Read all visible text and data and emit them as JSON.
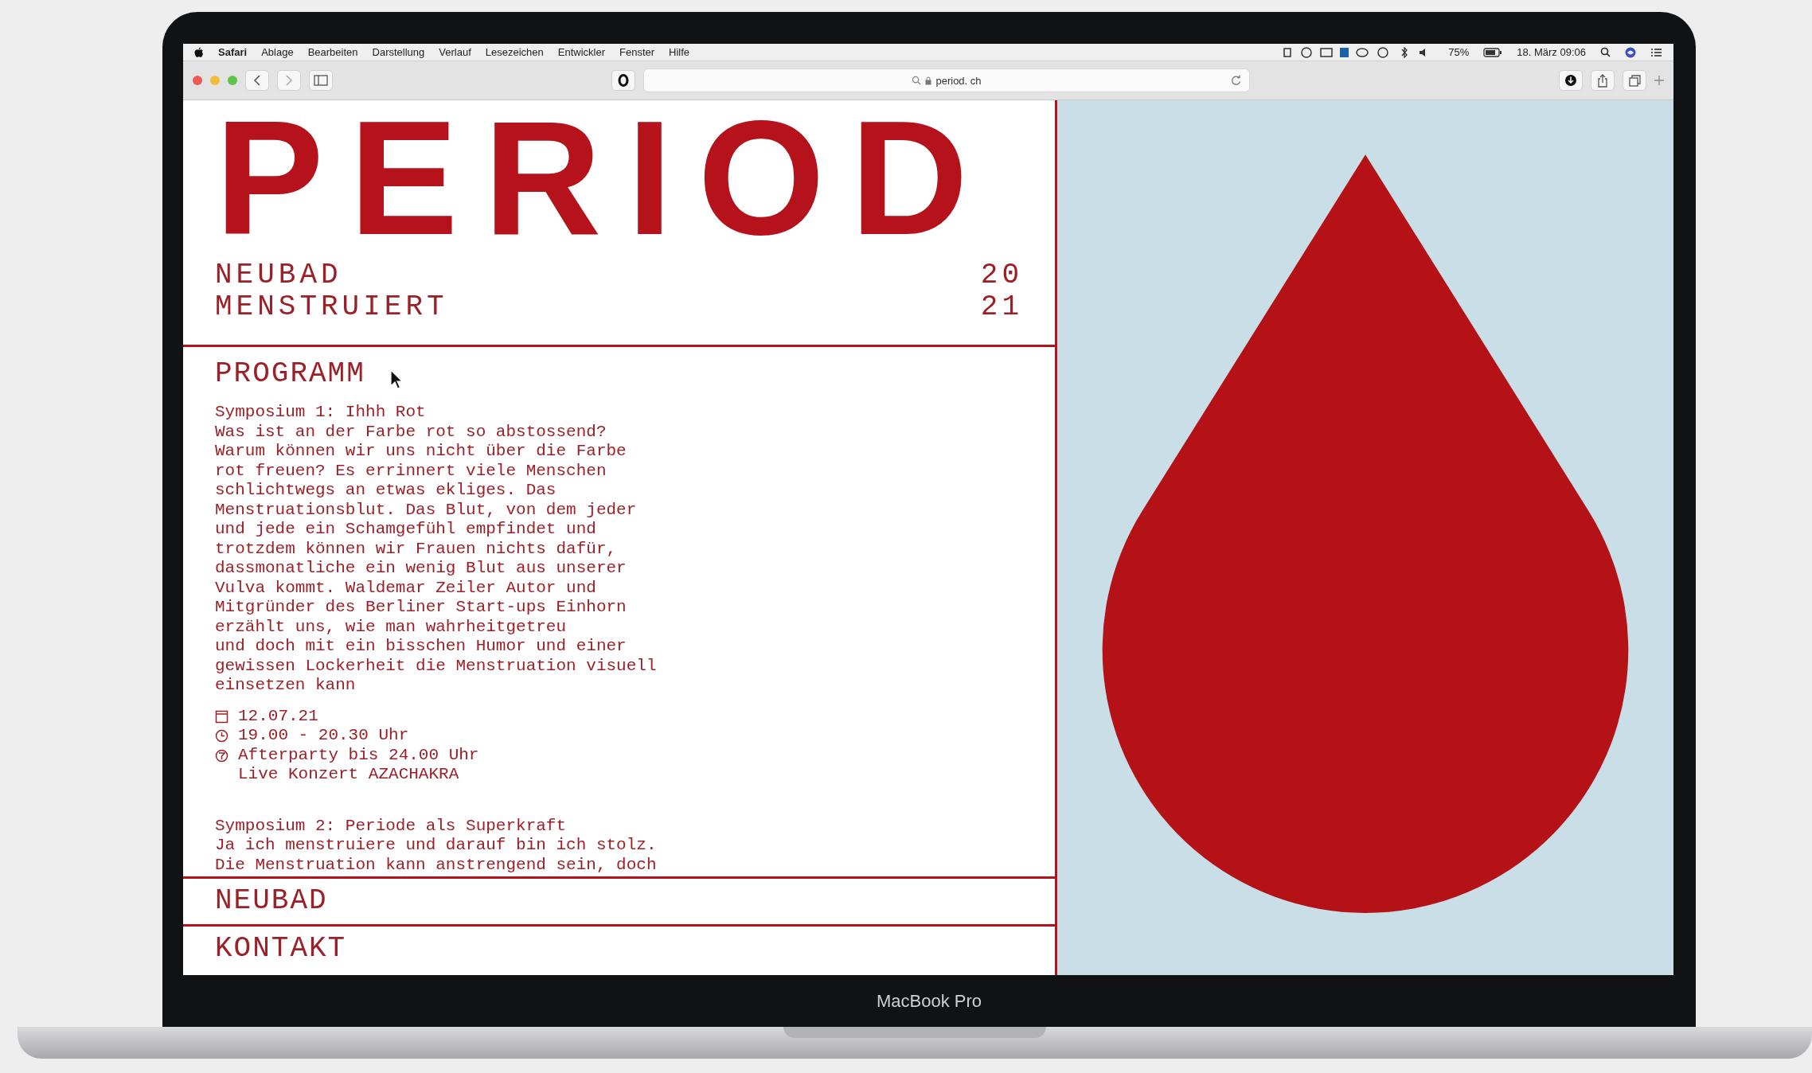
{
  "menu_bar": {
    "app_name": "Safari",
    "menus": [
      "Ablage",
      "Bearbeiten",
      "Darstellung",
      "Verlauf",
      "Lesezeichen",
      "Entwickler",
      "Fenster",
      "Hilfe"
    ],
    "battery": "75%",
    "clock": "18. März 09:06"
  },
  "toolbar": {
    "address": "period. ch"
  },
  "site": {
    "title": "PERIOD",
    "subtitle_lines": [
      "NEUBAD",
      "MENSTRUIERT"
    ],
    "year_lines": [
      "20",
      "21"
    ],
    "program": {
      "heading": "PROGRAMM",
      "events": [
        {
          "title": "Symposium 1: Ihhh Rot",
          "description": "Was ist an der Farbe rot so abstossend?\nWarum können wir uns nicht über die Farbe\nrot freuen? Es errinnert viele Menschen\nschlichtwegs an etwas ekliges. Das\nMenstruationsblut. Das Blut, von dem jeder\nund jede ein Schamgefühl empfindet und\ntrotzdem können wir Frauen nichts dafür,\ndassmonatliche ein wenig Blut aus unserer\nVulva kommt. Waldemar Zeiler Autor und\nMitgründer des Berliner Start-ups Einhorn\nerzählt uns, wie man wahrheitgetreu\nund doch mit ein bisschen Humor und einer\ngewissen Lockerheit die Menstruation visuell\neinsetzen kann",
          "details": [
            {
              "kind": "date",
              "text": "12.07.21"
            },
            {
              "kind": "time",
              "text": "19.00 - 20.30 Uhr"
            },
            {
              "kind": "party",
              "text": "Afterparty bis 24.00 Uhr\nLive Konzert AZACHAKRA"
            }
          ]
        },
        {
          "title": "Symposium 2: Periode als Superkraft",
          "description": "Ja ich menstruiere und darauf bin ich stolz.\nDie Menstruation kann anstrengend sein, doch"
        }
      ]
    },
    "nav": [
      "NEUBAD",
      "KONTAKT"
    ]
  },
  "laptop_label": "MacBook Pro"
}
